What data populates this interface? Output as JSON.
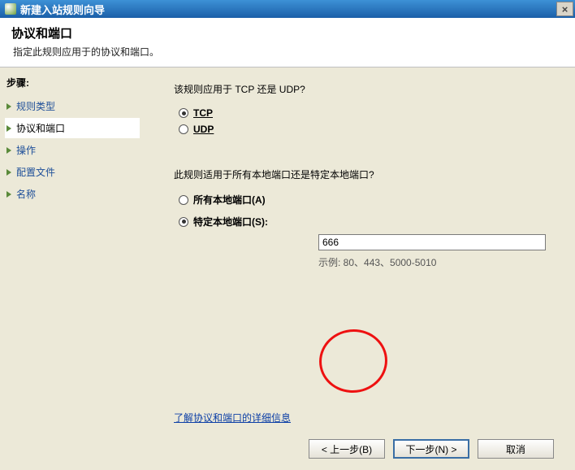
{
  "window": {
    "title": "新建入站规则向导",
    "close": "×"
  },
  "header": {
    "title": "协议和端口",
    "description": "指定此规则应用于的协议和端口。"
  },
  "sidebar": {
    "heading": "步骤:",
    "items": [
      {
        "label": "规则类型"
      },
      {
        "label": "协议和端口"
      },
      {
        "label": "操作"
      },
      {
        "label": "配置文件"
      },
      {
        "label": "名称"
      }
    ]
  },
  "main": {
    "q1": "该规则应用于 TCP 还是 UDP?",
    "tcp": "TCP",
    "udp": "UDP",
    "q2": "此规则适用于所有本地端口还是特定本地端口?",
    "all_ports": "所有本地端口(A)",
    "specific_ports": "特定本地端口(S):",
    "port_value": "666",
    "example": "示例: 80、443、5000-5010",
    "learn_link": "了解协议和端口的详细信息"
  },
  "buttons": {
    "back": "< 上一步(B)",
    "next": "下一步(N) >",
    "cancel": "取消"
  }
}
